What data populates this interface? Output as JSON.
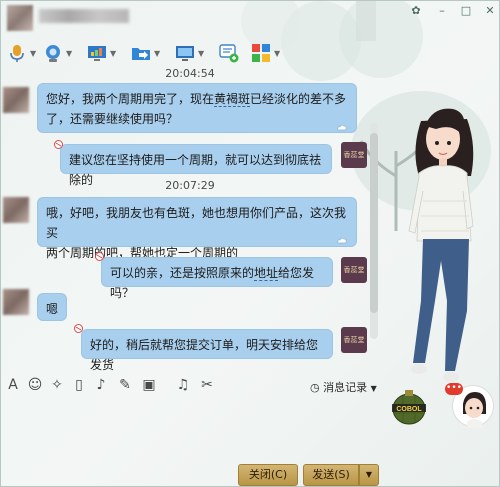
{
  "window": {
    "controls": {
      "skin": "✿",
      "minimize": "–",
      "maximize": "□",
      "close": "✕"
    }
  },
  "toolbar": {
    "items": [
      {
        "icon": "microphone-icon"
      },
      {
        "icon": "camera-icon"
      },
      {
        "icon": "screen-share-icon"
      },
      {
        "icon": "folder-transfer-icon"
      },
      {
        "icon": "remote-desktop-icon"
      },
      {
        "icon": "add-chat-icon"
      },
      {
        "icon": "apps-icon"
      }
    ]
  },
  "messages": [
    {
      "time": "20:04:54"
    },
    {
      "from": "customer",
      "lines": [
        "您好，我两个周期用完了，现在",
        "黄褐斑",
        "已经淡化的差不多",
        "了，还需要继续使用吗？"
      ]
    },
    {
      "from": "shop",
      "text": "建议您在坚持使用一个周期，就可以达到彻底祛除的"
    },
    {
      "time": "20:07:29"
    },
    {
      "from": "customer",
      "lines": [
        "哦，好吧，我朋友也有色斑，她也想用你们产品，这次我买",
        "两个周期的吧，帮她也定一个周期的"
      ]
    },
    {
      "from": "shop",
      "lines": [
        "可以的亲，还是按照原来的",
        "地址",
        "给您发吗？"
      ]
    },
    {
      "from": "customer",
      "text": "嗯"
    },
    {
      "from": "shop",
      "text": "好的，稍后就帮您提交订单，明天安排给您发货"
    }
  ],
  "shop_avatar_text": "香蕊堂",
  "input_toolbar": {
    "tools": [
      "font-icon",
      "emoji-icon",
      "magic-wand-icon",
      "shake-icon",
      "voice-icon",
      "edit-icon",
      "image-icon",
      "music-icon",
      "screenshot-scissors-icon"
    ],
    "history_label": "消息记录"
  },
  "buttons": {
    "close_label": "关闭(C)",
    "send_label": "发送(S)"
  },
  "right_panel": {
    "cobol_label": "COBOL"
  },
  "colors": {
    "bubble": "#a9cfee",
    "button_gold": "#c9a95c",
    "shop_avatar": "#5a3a4c"
  }
}
